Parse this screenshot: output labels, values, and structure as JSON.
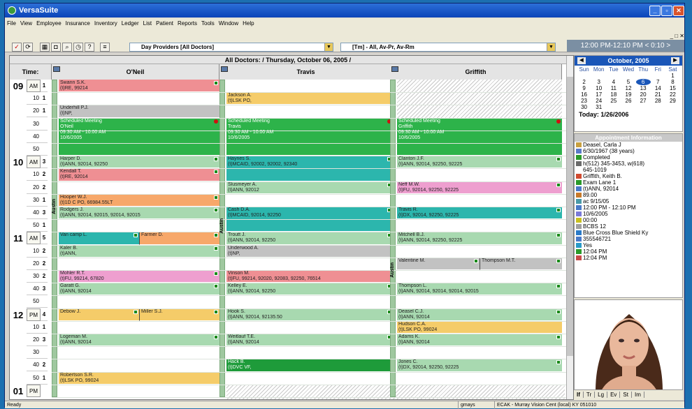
{
  "window": {
    "title": "VersaSuite"
  },
  "menu": [
    "File",
    "View",
    "Employee",
    "Insurance",
    "Inventory",
    "Ledger",
    "List",
    "Patient",
    "Reports",
    "Tools",
    "Window",
    "Help"
  ],
  "toolbar": {
    "provider_select": "Day Providers [All Doctors]",
    "time_filter": "[Tm] - All, Av-Pr, Av-Rm",
    "time_range": "12:00 PM-12:10 PM < 0:10 >"
  },
  "schedule": {
    "header": "All Doctors: / Thursday, October 06, 2005 /",
    "time_label": "Time:",
    "columns": [
      "O'Neil",
      "Travis",
      "Griffith"
    ],
    "room_label": "Austin",
    "hours": [
      {
        "h": "09",
        "ap": "AM",
        "counts": [
          "1",
          "1",
          "1",
          "",
          "",
          ""
        ]
      },
      {
        "h": "10",
        "ap": "AM",
        "counts": [
          "3",
          "2",
          "2",
          "1",
          "3",
          "1"
        ]
      },
      {
        "h": "11",
        "ap": "AM",
        "counts": [
          "5",
          "2",
          "2",
          "2",
          "3",
          ""
        ]
      },
      {
        "h": "12",
        "ap": "PM",
        "counts": [
          "4",
          "1",
          "3",
          "",
          "2",
          "1"
        ]
      }
    ],
    "next_hour": "01",
    "next_ap": "PM",
    "minutes": [
      "",
      "10",
      "20",
      "30",
      "40",
      "50"
    ],
    "appointments": [
      {
        "col": 0,
        "slot": 0,
        "len": 1,
        "c": "rose",
        "t1": "Swann S.K.",
        "t2": "(t)RE, 99214",
        "dot": true
      },
      {
        "col": 1,
        "slot": 1,
        "len": 1,
        "c": "yel",
        "t1": "Jackson A.",
        "t2": "(t)LSK PO,",
        "dot": false
      },
      {
        "col": 0,
        "slot": 2,
        "len": 1,
        "c": "gray",
        "t1": "Underhill P.J.",
        "t2": "(t)NP,",
        "dot": false
      },
      {
        "col": 0,
        "slot": 3,
        "len": 3,
        "c": "green",
        "t1": "Scheduled Meeting",
        "t2": "O'Neil",
        "t3": "09:30 AM - 10:00 AM",
        "t4": "10/6/2005",
        "rdot": true
      },
      {
        "col": 1,
        "slot": 3,
        "len": 3,
        "c": "green",
        "t1": "Scheduled Meeting",
        "t2": "Travis",
        "t3": "09:30 AM - 10:00 AM",
        "t4": "10/6/2005",
        "rdot": true
      },
      {
        "col": 2,
        "slot": 3,
        "len": 3,
        "c": "green",
        "t1": "Scheduled Meeting",
        "t2": "Griffith",
        "t3": "09:30 AM - 10:00 AM",
        "t4": "10/6/2005",
        "rdot": true
      },
      {
        "col": 0,
        "slot": 6,
        "len": 1,
        "c": "mint",
        "t1": "Harper D.",
        "t2": "(t)ANN, 92014, 92250",
        "dot": true
      },
      {
        "col": 1,
        "slot": 6,
        "len": 2,
        "c": "teal",
        "t1": "Haynes S.",
        "t2": "(t)MCAID, 92002, 92002, 92340",
        "dot": true
      },
      {
        "col": 2,
        "slot": 6,
        "len": 1,
        "c": "mint",
        "t1": "Clanton J.F.",
        "t2": "(t)ANN, 92014, 92250, 92225",
        "dot": true
      },
      {
        "col": 0,
        "slot": 7,
        "len": 1,
        "c": "rose",
        "t1": "Kendall T.",
        "t2": "(t)RE, 92014",
        "dot": true
      },
      {
        "col": 1,
        "slot": 8,
        "len": 1,
        "c": "mint",
        "t1": "Slusmeyer A.",
        "t2": "(t)ANN, 92012",
        "dot": true
      },
      {
        "col": 2,
        "slot": 8,
        "len": 1,
        "c": "pink",
        "t1": "Neff M.W.",
        "t2": "(t)FU, 92014, 92250, 92225",
        "dot": true
      },
      {
        "col": 0,
        "slot": 9,
        "len": 1,
        "c": "peach",
        "t1": "Hooper W.J.",
        "t2": "(t)1D C PO, 66984.55LT",
        "dot": true
      },
      {
        "col": 0,
        "slot": 10,
        "len": 1,
        "c": "mint",
        "t1": "Rodgers J.",
        "t2": "(t)ANN, 92014, 92015, 92014, 92015",
        "dot": true
      },
      {
        "col": 1,
        "slot": 10,
        "len": 2,
        "c": "teal",
        "t1": "Cash D.A.",
        "t2": "(t)MCAID, 92014, 92250",
        "dot": true
      },
      {
        "col": 2,
        "slot": 10,
        "len": 1,
        "c": "teal",
        "t1": "Travis R.",
        "t2": "(t)DX, 92014, 92250, 92225",
        "dot": true
      },
      {
        "col": 0,
        "slot": 12,
        "len": 1,
        "c": "teal",
        "t1": "Van camp L.",
        "t2": "",
        "split": "Farmer D.",
        "dot": true
      },
      {
        "col": 1,
        "slot": 12,
        "len": 1,
        "c": "mint",
        "t1": "Troutt J.",
        "t2": "(t)ANN, 92014, 92250",
        "dot": true
      },
      {
        "col": 2,
        "slot": 12,
        "len": 1,
        "c": "mint",
        "t1": "Mitchell B.J.",
        "t2": "(t)ANN, 92014, 92250, 92225",
        "dot": true
      },
      {
        "col": 0,
        "slot": 13,
        "len": 1,
        "c": "mint",
        "t1": "Kaler B.",
        "t2": "(t)ANN,",
        "dot": true
      },
      {
        "col": 1,
        "slot": 13,
        "len": 1,
        "c": "gray",
        "t1": "Underwood A.",
        "t2": "(t)NP,",
        "dot": false
      },
      {
        "col": 2,
        "slot": 14,
        "len": 1,
        "c": "gray",
        "t1": "Valentine M.",
        "t2": "",
        "split": "Thompson M.T.",
        "dot": true
      },
      {
        "col": 0,
        "slot": 15,
        "len": 1,
        "c": "pink",
        "t1": "Mohler R.T.",
        "t2": "(t)FU, 99214, 67820",
        "dot": true
      },
      {
        "col": 1,
        "slot": 15,
        "len": 1,
        "c": "rose",
        "t1": "Vinson M.",
        "t2": "(t)FU, 99214, 92020, 92083, 92250, 76514",
        "dot": false
      },
      {
        "col": 0,
        "slot": 16,
        "len": 1,
        "c": "mint",
        "t1": "Garatt G.",
        "t2": "(t)ANN, 92014",
        "dot": true
      },
      {
        "col": 1,
        "slot": 16,
        "len": 1,
        "c": "mint",
        "t1": "Kelley E.",
        "t2": "(t)ANN, 92014, 92250",
        "dot": true
      },
      {
        "col": 2,
        "slot": 16,
        "len": 1,
        "c": "mint",
        "t1": "Thompson L.",
        "t2": "(t)ANN, 92014, 92014, 92014, 92015",
        "dot": true
      },
      {
        "col": 0,
        "slot": 18,
        "len": 1,
        "c": "yel",
        "t1": "Debow J.",
        "t2": "",
        "split": "Miller S.J.",
        "dot": true
      },
      {
        "col": 1,
        "slot": 18,
        "len": 1,
        "c": "mint",
        "t1": "Hook S.",
        "t2": "(t)ANN, 92014, 92135.50",
        "dot": true
      },
      {
        "col": 2,
        "slot": 18,
        "len": 1,
        "c": "mint",
        "t1": "Deasel C.J.",
        "t2": "(t)ANN, 92014",
        "dot": true
      },
      {
        "col": 2,
        "slot": 19,
        "len": 1,
        "c": "yel",
        "t1": "Hudson C.A.",
        "t2": "(t)LSK PO, 99024",
        "dot": false
      },
      {
        "col": 0,
        "slot": 20,
        "len": 1,
        "c": "mint",
        "t1": "Logeman M.",
        "t2": "(t)ANN, 92014",
        "dot": true
      },
      {
        "col": 1,
        "slot": 20,
        "len": 1,
        "c": "mint",
        "t1": "Weitlauf T.E.",
        "t2": "(t)ANN, 92014",
        "dot": true
      },
      {
        "col": 2,
        "slot": 20,
        "len": 1,
        "c": "mint",
        "t1": "Adams K.",
        "t2": "(t)ANN, 92014",
        "dot": true
      },
      {
        "col": 1,
        "slot": 22,
        "len": 1,
        "c": "dgreen",
        "t1": "Hack B.",
        "t2": "(t)DVC VF,",
        "dot": false
      },
      {
        "col": 2,
        "slot": 22,
        "len": 1,
        "c": "mint",
        "t1": "Jones C.",
        "t2": "(t)DX, 92014, 92250, 92225",
        "dot": true
      },
      {
        "col": 0,
        "slot": 23,
        "len": 1,
        "c": "yel",
        "t1": "Robertson S.R.",
        "t2": "(t)LSK PO, 99024",
        "dot": false
      }
    ]
  },
  "calendar": {
    "month": "October, 2005",
    "weekdays": [
      "Sun",
      "Mon",
      "Tue",
      "Wed",
      "Thu",
      "Fri",
      "Sat"
    ],
    "days": [
      "",
      "",
      "",
      "",
      "",
      "",
      "1",
      "2",
      "3",
      "4",
      "5",
      "6",
      "7",
      "8",
      "9",
      "10",
      "11",
      "12",
      "13",
      "14",
      "15",
      "16",
      "17",
      "18",
      "19",
      "20",
      "21",
      "22",
      "23",
      "24",
      "25",
      "26",
      "27",
      "28",
      "29",
      "30",
      "31"
    ],
    "today": "Today: 1/26/2006"
  },
  "appointment_info": {
    "title": "Appointment Information",
    "lines": [
      "Deasel, Carla J",
      "6/30/1967 (38 years)",
      "Completed",
      "h(512) 345-3453, w(618)",
      "645-1019",
      "Griffith, Keith B.",
      "Exam Lane 1",
      "(t)ANN, 92014",
      "89.00",
      "",
      "ac 9/15/05",
      "12:00 PM - 12:10 PM",
      "10/6/2005",
      "00:00",
      "BCBS 12",
      "Blue Cross Blue Shield Ky",
      "355546721",
      "Yes",
      "12:04 PM",
      "12:04 PM"
    ]
  },
  "right_tabs": [
    "If",
    "Tr",
    "Lg",
    "Ev",
    "St",
    "Im"
  ],
  "status": {
    "left": "Ready",
    "user": "gmays",
    "location": "ECAK - Murray Vision Cent (local) KY 051010"
  }
}
